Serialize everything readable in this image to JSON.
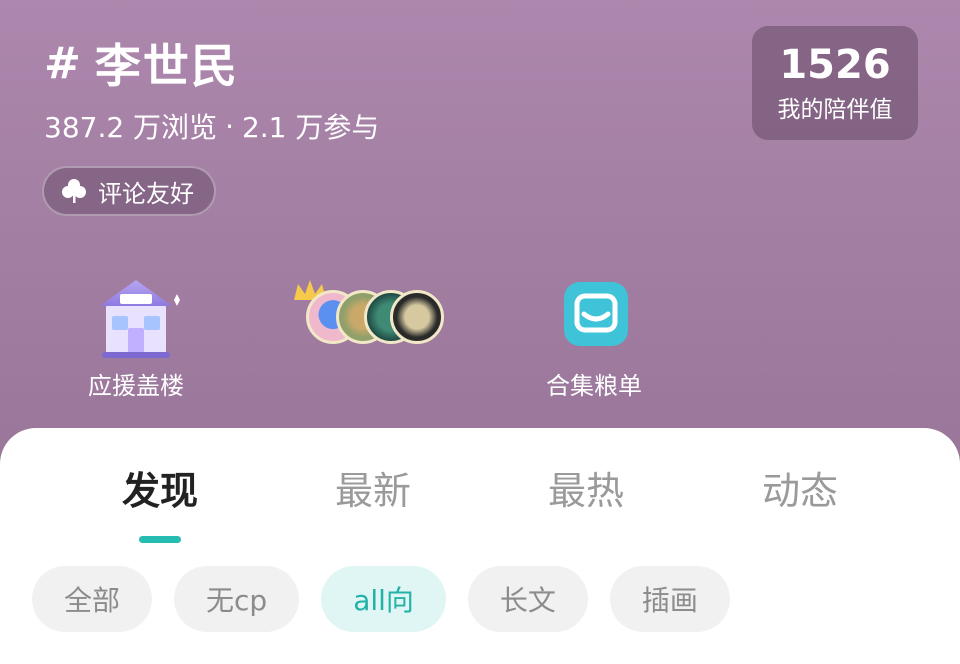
{
  "header": {
    "hash": "#",
    "title": "李世民",
    "views": "387.2 万浏览",
    "separator": "·",
    "participants": "2.1 万参与",
    "badge_label": "评论友好"
  },
  "companion": {
    "value": "1526",
    "label": "我的陪伴值"
  },
  "features": [
    {
      "label": "应援盖楼",
      "icon": "building-icon"
    },
    {
      "label": "",
      "icon": "avatars-group-icon"
    },
    {
      "label": "合集粮单",
      "icon": "collection-icon"
    }
  ],
  "tabs": [
    {
      "label": "发现"
    },
    {
      "label": "最新"
    },
    {
      "label": "最热"
    },
    {
      "label": "动态"
    }
  ],
  "active_tab": "发现",
  "chips": [
    {
      "label": "全部"
    },
    {
      "label": "无cp"
    },
    {
      "label": "all向"
    },
    {
      "label": "长文"
    },
    {
      "label": "插画"
    }
  ],
  "active_chip": "all向",
  "colors": {
    "header_bg": "#a982a7",
    "accent": "#26bcb2",
    "chip_active_bg": "#e0f6f4"
  }
}
